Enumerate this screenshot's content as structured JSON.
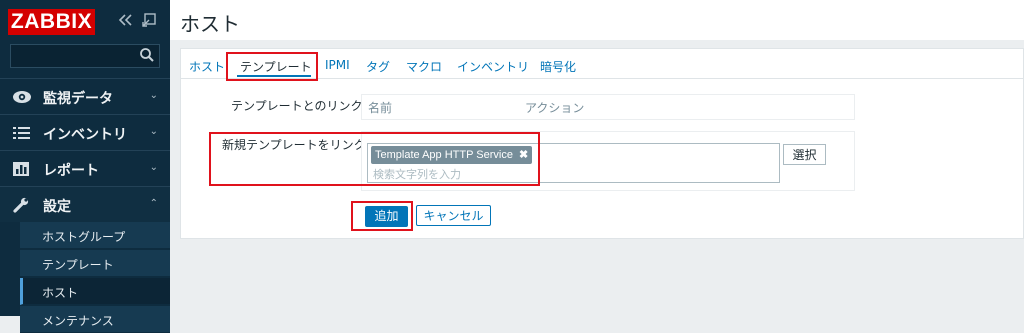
{
  "app": {
    "logo": "ZABBIX"
  },
  "sidebar": {
    "menu": [
      {
        "label": "監視データ"
      },
      {
        "label": "インベントリ"
      },
      {
        "label": "レポート"
      },
      {
        "label": "設定"
      }
    ],
    "sub_items": [
      {
        "label": "ホストグループ"
      },
      {
        "label": "テンプレート"
      },
      {
        "label": "ホスト"
      },
      {
        "label": "メンテナンス"
      }
    ]
  },
  "header": {
    "title": "ホスト"
  },
  "tabs": [
    {
      "label": "ホスト"
    },
    {
      "label": "テンプレート"
    },
    {
      "label": "IPMI"
    },
    {
      "label": "タグ"
    },
    {
      "label": "マクロ"
    },
    {
      "label": "インベントリ"
    },
    {
      "label": "暗号化"
    }
  ],
  "form": {
    "linked_label": "テンプレートとのリンク",
    "col_name": "名前",
    "col_action": "アクション",
    "new_link_label": "新規テンプレートをリンク",
    "selected_template": "Template App HTTP Service",
    "search_placeholder": "検索文字列を入力",
    "select_button": "選択",
    "add_button": "追加",
    "cancel_button": "キャンセル"
  },
  "colors": {
    "accent": "#0275b8",
    "sidebar": "#0e2c3f",
    "logo": "#d40000",
    "highlight": "#e0121c"
  }
}
